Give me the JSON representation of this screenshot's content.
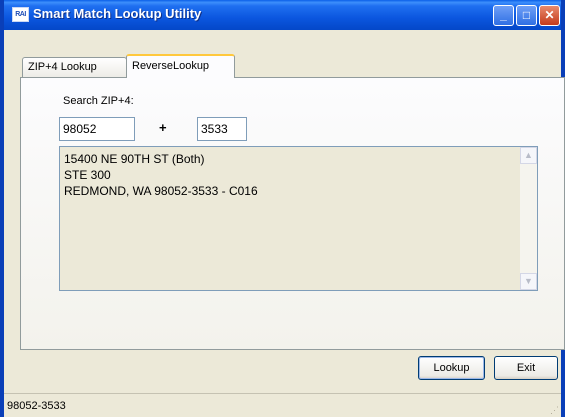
{
  "window": {
    "title": "Smart Match Lookup Utility",
    "app_icon_text": "RAI",
    "controls": {
      "minimize": "_",
      "maximize": "□",
      "close": "✕"
    },
    "icons": {
      "minimize": "minimize-icon",
      "maximize": "maximize-icon",
      "close": "close-icon"
    }
  },
  "tabs": [
    {
      "label": "ZIP+4 Lookup",
      "active": false
    },
    {
      "label": "ReverseLookup",
      "active": true
    }
  ],
  "form": {
    "search_label": "Search ZIP+4:",
    "zip_value": "98052",
    "plus_sign": "+",
    "plus4_value": "3533"
  },
  "result": {
    "lines": [
      "15400 NE 90TH  ST (Both)",
      "STE 300",
      "REDMOND, WA  98052-3533 - C016"
    ]
  },
  "buttons": {
    "lookup": "Lookup",
    "exit": "Exit"
  },
  "statusbar": {
    "text": "98052-3533"
  },
  "colors": {
    "title_bar": "#0b56df",
    "window_bg": "#ece9d8",
    "tab_highlight": "#ffc83c"
  }
}
